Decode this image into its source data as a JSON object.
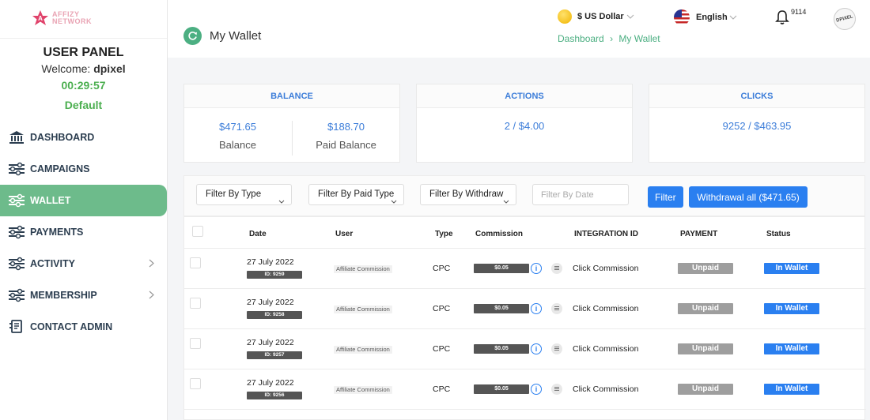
{
  "logo": {
    "text_line1": "AFFIZY",
    "text_line2": "NETWORK"
  },
  "user_panel": {
    "title": "USER PANEL",
    "welcome_prefix": "Welcome:",
    "username": "dpixel",
    "timer": "00:29:57",
    "plan": "Default"
  },
  "sidebar": {
    "items": [
      {
        "label": "DASHBOARD",
        "icon": "bank-icon"
      },
      {
        "label": "CAMPAIGNS",
        "icon": "sliders-icon"
      },
      {
        "label": "WALLET",
        "icon": "sliders-icon",
        "active": true
      },
      {
        "label": "PAYMENTS",
        "icon": "sliders-icon"
      },
      {
        "label": "ACTIVITY",
        "icon": "sliders-icon",
        "has_submenu": true
      },
      {
        "label": "MEMBERSHIP",
        "icon": "sliders-icon",
        "has_submenu": true
      },
      {
        "label": "CONTACT ADMIN",
        "icon": "contact-icon"
      }
    ]
  },
  "header": {
    "page_title": "My Wallet",
    "currency": "$ US Dollar",
    "language": "English",
    "notification_count": "9114",
    "avatar_text": "DPIXEL",
    "breadcrumb": {
      "home": "Dashboard",
      "separator": "›",
      "current": "My Wallet"
    }
  },
  "cards": {
    "balance": {
      "title": "BALANCE",
      "balance_value": "$471.65",
      "balance_label": "Balance",
      "paid_value": "$188.70",
      "paid_label": "Paid Balance"
    },
    "actions": {
      "title": "ACTIONS",
      "value": "2 / $4.00"
    },
    "clicks": {
      "title": "CLICKS",
      "value": "9252 / $463.95"
    }
  },
  "filters": {
    "type": "Filter By Type",
    "paid_type": "Filter By Paid Type",
    "withdraw": "Filter By Withdraw",
    "date_placeholder": "Filter By Date",
    "filter_button": "Filter",
    "withdraw_all_button": "Withdrawal all ($471.65)"
  },
  "table": {
    "headers": {
      "date": "Date",
      "user": "User",
      "type": "Type",
      "commission": "Commission",
      "integration_id": "INTEGRATION ID",
      "payment": "PAYMENT",
      "status": "Status"
    },
    "rows": [
      {
        "date": "27 July 2022",
        "id": "ID: 9259",
        "user": "Affiliate Commission",
        "type": "CPC",
        "commission": "$0.05",
        "integration": "Click Commission",
        "payment": "Unpaid",
        "status": "In Wallet"
      },
      {
        "date": "27 July 2022",
        "id": "ID: 9258",
        "user": "Affiliate Commission",
        "type": "CPC",
        "commission": "$0.05",
        "integration": "Click Commission",
        "payment": "Unpaid",
        "status": "In Wallet"
      },
      {
        "date": "27 July 2022",
        "id": "ID: 9257",
        "user": "Affiliate Commission",
        "type": "CPC",
        "commission": "$0.05",
        "integration": "Click Commission",
        "payment": "Unpaid",
        "status": "In Wallet"
      },
      {
        "date": "27 July 2022",
        "id": "ID: 9256",
        "user": "Affiliate Commission",
        "type": "CPC",
        "commission": "$0.05",
        "integration": "Click Commission",
        "payment": "Unpaid",
        "status": "In Wallet"
      }
    ]
  },
  "colors": {
    "accent_green": "#6dbb8b",
    "accent_blue": "#2a7ff0",
    "badge_gray": "#9e9e9e"
  }
}
